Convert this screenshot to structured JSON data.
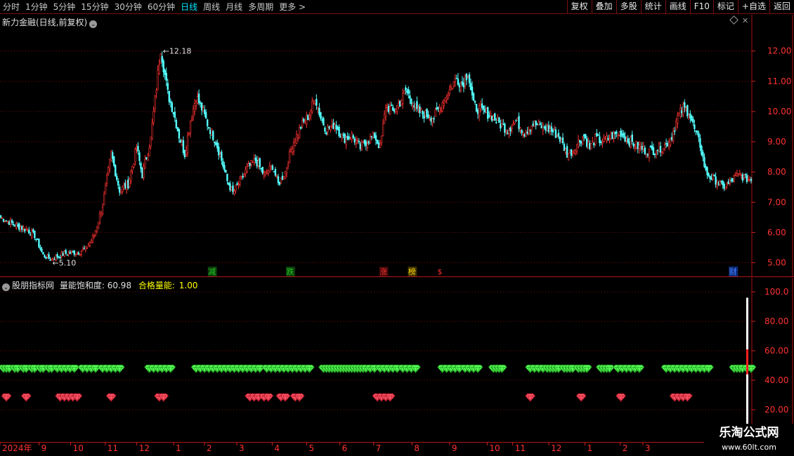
{
  "toolbar": {
    "periods": [
      {
        "label": "分时",
        "active": false
      },
      {
        "label": "1分钟",
        "active": false
      },
      {
        "label": "5分钟",
        "active": false
      },
      {
        "label": "15分钟",
        "active": false
      },
      {
        "label": "30分钟",
        "active": false
      },
      {
        "label": "60分钟",
        "active": false
      },
      {
        "label": "日线",
        "active": true
      },
      {
        "label": "周线",
        "active": false
      },
      {
        "label": "月线",
        "active": false
      },
      {
        "label": "多周期",
        "active": false
      },
      {
        "label": "更多 >",
        "active": false
      }
    ],
    "actions": [
      "复权",
      "叠加",
      "多股",
      "统计",
      "画线",
      "F10",
      "标记",
      "+自选",
      "返回"
    ]
  },
  "main_chart": {
    "title": "新力金融(日线,前复权)",
    "max_label": "12.18",
    "min_label": "5.10",
    "price_ticks": [
      "12.00",
      "11.00",
      "10.00",
      "9.00",
      "8.00",
      "7.00",
      "6.00",
      "5.00"
    ],
    "markers": [
      {
        "text": "减",
        "color": "#22cc22"
      },
      {
        "text": "跌",
        "color": "#22cc22"
      },
      {
        "text": "涨",
        "color": "#ff3030"
      },
      {
        "text": "榜",
        "color": "#ffd700"
      },
      {
        "text": "$",
        "color": "#ff3030"
      },
      {
        "text": "财",
        "color": "#4a80ff"
      }
    ]
  },
  "indicator": {
    "name": "股朋指标网",
    "label1": "量能饱和度:",
    "value1": "60.98",
    "label2": "合格量能:",
    "value2": "1.00",
    "ticks": [
      "100.0",
      "80.00",
      "60.00",
      "40.00",
      "20.00"
    ]
  },
  "time_axis": {
    "labels": [
      "2024年",
      "9",
      "10",
      "11",
      "12",
      "1",
      "2",
      "3",
      "4",
      "5",
      "6",
      "7",
      "8",
      "9",
      "10",
      "11",
      "12",
      "1",
      "2",
      "3"
    ]
  },
  "watermark": {
    "title": "乐淘公式网",
    "url": "www.60lt.com"
  },
  "colors": {
    "up": "#ff3232",
    "down": "#54ffff",
    "grid": "#7a1010",
    "green_gem": "#33ee33",
    "red_gem": "#ff3344"
  },
  "chart_data": {
    "type": "candlestick",
    "y_range": [
      4.85,
      12.55
    ],
    "price_segments": [
      [
        0,
        6.5
      ],
      [
        10,
        6.25
      ],
      [
        18,
        6.1
      ],
      [
        24,
        5.9
      ],
      [
        30,
        5.25
      ],
      [
        35,
        5.12
      ],
      [
        45,
        5.3
      ],
      [
        55,
        5.35
      ],
      [
        60,
        5.45
      ],
      [
        66,
        5.9
      ],
      [
        72,
        6.9
      ],
      [
        78,
        8.6
      ],
      [
        84,
        7.4
      ],
      [
        90,
        7.6
      ],
      [
        96,
        8.8
      ],
      [
        100,
        7.9
      ],
      [
        106,
        9.1
      ],
      [
        110,
        10.8
      ],
      [
        113,
        12.1
      ],
      [
        118,
        10.6
      ],
      [
        122,
        10.0
      ],
      [
        126,
        9.2
      ],
      [
        130,
        8.6
      ],
      [
        134,
        9.7
      ],
      [
        138,
        10.5
      ],
      [
        142,
        10.1
      ],
      [
        146,
        9.6
      ],
      [
        152,
        9.0
      ],
      [
        156,
        8.4
      ],
      [
        160,
        7.7
      ],
      [
        164,
        7.3
      ],
      [
        168,
        7.6
      ],
      [
        174,
        8.1
      ],
      [
        180,
        8.4
      ],
      [
        186,
        7.9
      ],
      [
        192,
        8.2
      ],
      [
        196,
        7.6
      ],
      [
        201,
        8.0
      ],
      [
        206,
        8.9
      ],
      [
        212,
        9.5
      ],
      [
        218,
        9.9
      ],
      [
        222,
        10.5
      ],
      [
        226,
        9.8
      ],
      [
        230,
        9.4
      ],
      [
        236,
        9.6
      ],
      [
        242,
        9.1
      ],
      [
        248,
        9.2
      ],
      [
        254,
        8.8
      ],
      [
        258,
        9.0
      ],
      [
        264,
        9.2
      ],
      [
        268,
        8.8
      ],
      [
        272,
        10.2
      ],
      [
        277,
        10.0
      ],
      [
        282,
        10.3
      ],
      [
        286,
        10.7
      ],
      [
        290,
        10.4
      ],
      [
        294,
        10.0
      ],
      [
        300,
        9.9
      ],
      [
        306,
        9.8
      ],
      [
        312,
        10.3
      ],
      [
        318,
        10.8
      ],
      [
        322,
        11.1
      ],
      [
        326,
        10.9
      ],
      [
        330,
        11.3
      ],
      [
        334,
        10.2
      ],
      [
        340,
        10.0
      ],
      [
        346,
        9.9
      ],
      [
        352,
        9.6
      ],
      [
        358,
        9.4
      ],
      [
        364,
        9.7
      ],
      [
        370,
        9.3
      ],
      [
        376,
        9.6
      ],
      [
        382,
        9.5
      ],
      [
        388,
        9.4
      ],
      [
        394,
        9.2
      ],
      [
        400,
        8.6
      ],
      [
        404,
        8.7
      ],
      [
        408,
        9.0
      ],
      [
        412,
        9.2
      ],
      [
        416,
        8.8
      ],
      [
        420,
        9.1
      ],
      [
        426,
        9.0
      ],
      [
        432,
        9.2
      ],
      [
        438,
        9.3
      ],
      [
        442,
        9.1
      ],
      [
        448,
        8.9
      ],
      [
        452,
        8.8
      ],
      [
        456,
        8.7
      ],
      [
        460,
        8.7
      ],
      [
        466,
        8.8
      ],
      [
        470,
        8.9
      ],
      [
        474,
        9.2
      ],
      [
        478,
        9.8
      ],
      [
        482,
        10.1
      ],
      [
        486,
        10.0
      ],
      [
        490,
        9.4
      ],
      [
        494,
        8.9
      ],
      [
        498,
        8.0
      ],
      [
        502,
        7.8
      ],
      [
        506,
        7.7
      ],
      [
        510,
        7.5
      ],
      [
        514,
        7.6
      ],
      [
        518,
        7.8
      ],
      [
        522,
        7.9
      ],
      [
        526,
        7.8
      ],
      [
        530,
        7.75
      ]
    ],
    "green_gem_groups": [
      [
        0,
        4
      ],
      [
        8,
        10
      ],
      [
        14,
        16
      ],
      [
        20,
        22
      ],
      [
        26,
        28
      ],
      [
        32,
        34
      ],
      [
        38,
        52
      ],
      [
        56,
        66
      ],
      [
        70,
        82
      ],
      [
        103,
        118
      ],
      [
        136,
        182
      ],
      [
        186,
        218
      ],
      [
        226,
        232
      ],
      [
        234,
        240
      ],
      [
        242,
        248
      ],
      [
        248,
        254
      ],
      [
        256,
        264
      ],
      [
        266,
        280
      ],
      [
        282,
        292
      ],
      [
        310,
        324
      ],
      [
        326,
        336
      ],
      [
        346,
        352
      ],
      [
        372,
        384
      ],
      [
        386,
        392
      ],
      [
        396,
        402
      ],
      [
        406,
        412
      ],
      [
        422,
        428
      ],
      [
        434,
        450
      ],
      [
        468,
        500
      ],
      [
        516,
        522
      ],
      [
        522,
        530
      ]
    ],
    "red_gem_groups": [
      [
        2,
        4
      ],
      [
        16,
        18
      ],
      [
        40,
        54
      ],
      [
        76,
        78
      ],
      [
        110,
        114
      ],
      [
        174,
        182
      ],
      [
        184,
        188
      ],
      [
        196,
        200
      ],
      [
        206,
        210
      ],
      [
        264,
        274
      ],
      [
        372,
        374
      ],
      [
        408,
        410
      ],
      [
        436,
        438
      ],
      [
        474,
        484
      ]
    ],
    "volume_spike": {
      "value": 60.98,
      "bar_index": 530
    }
  }
}
